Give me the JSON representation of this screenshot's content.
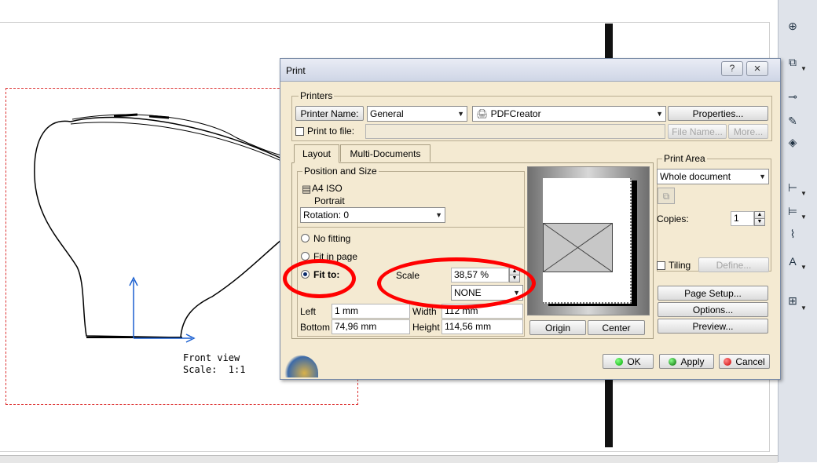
{
  "drawing": {
    "view_label_line1": "Front view",
    "view_label_line2": "Scale:  1:1"
  },
  "dialog": {
    "title": "Print",
    "help_button": "?",
    "close_button": "×",
    "printers": {
      "group_label": "Printers",
      "printer_name_button": "Printer Name:",
      "printer_name_value": "General",
      "printer_device": "PDFCreator",
      "properties_button": "Properties...",
      "print_to_file_label": "Print to file:",
      "print_to_file_checked": false,
      "file_name_button": "File Name...",
      "more_button": "More..."
    },
    "tabs": [
      "Layout",
      "Multi-Documents"
    ],
    "active_tab": "Layout",
    "position_and_size": {
      "group_label": "Position and Size",
      "paper_format": "A4 ISO",
      "orientation": "Portrait",
      "rotation": "Rotation: 0",
      "options": [
        {
          "label": "No fitting",
          "selected": false
        },
        {
          "label": "Fit in page",
          "selected": false
        },
        {
          "label": "Fit to:",
          "selected": true
        }
      ],
      "scale_label": "Scale",
      "scale_value": "38,57 %",
      "scale_unit_value": "NONE",
      "left_label": "Left",
      "left_value": "1 mm",
      "width_label": "Width",
      "width_value": "112 mm",
      "bottom_label": "Bottom",
      "bottom_value": "74,96 mm",
      "height_label": "Height",
      "height_value": "114,56 mm"
    },
    "preview": {
      "origin_button": "Origin",
      "center_button": "Center"
    },
    "print_area": {
      "group_label": "Print Area",
      "value": "Whole document",
      "copies_label": "Copies:",
      "copies_value": "1",
      "tiling_label": "Tiling",
      "tiling_checked": false,
      "define_button": "Define..."
    },
    "side_buttons": {
      "page_setup": "Page Setup...",
      "options": "Options...",
      "preview": "Preview..."
    },
    "footer": {
      "ok": "OK",
      "apply": "Apply",
      "cancel": "Cancel"
    }
  },
  "colors": {
    "annotation": "#ff0000",
    "dialog_bg": "#f4ead2",
    "axis": "#1a5fd0",
    "frame": "#dd3333"
  },
  "toolbar": {
    "icons": [
      "axis-system-icon",
      "layers-icon",
      "sheet-icon",
      "text-edit-icon",
      "color-icon",
      "dimension-icon",
      "dimension-chain-icon",
      "dimension-options-icon",
      "curve-icon",
      "text-box-icon",
      "stack-icon"
    ]
  }
}
